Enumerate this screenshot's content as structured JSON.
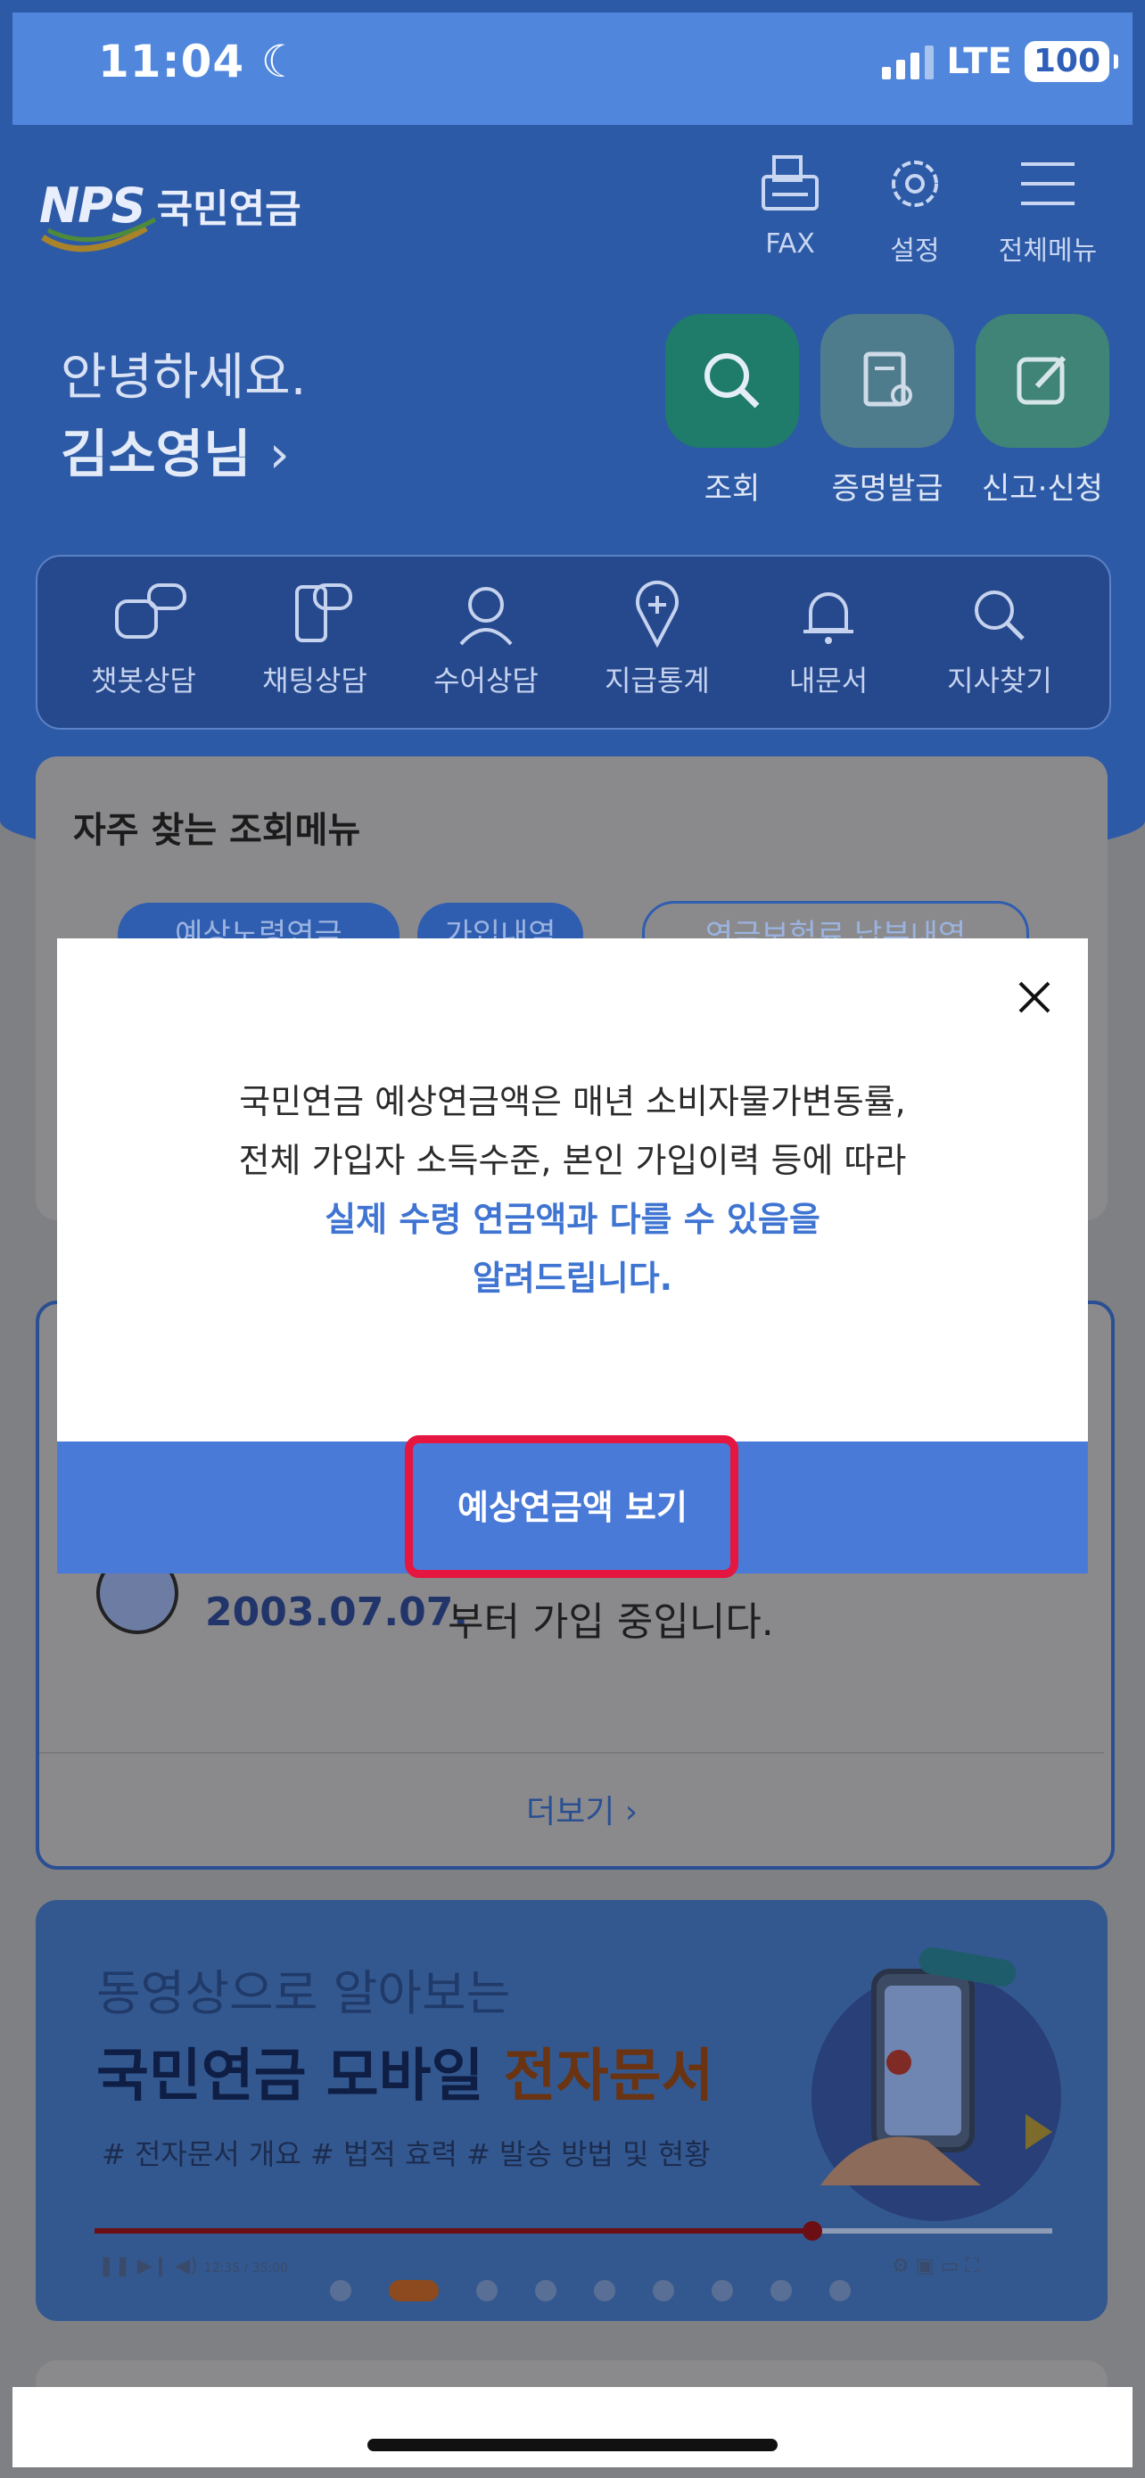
{
  "status_bar": {
    "time": "11:04",
    "network": "LTE",
    "battery": "100"
  },
  "header": {
    "logo_mark": "NPS",
    "logo_name": "국민연금",
    "icons": [
      {
        "label": "FAX",
        "icon": "fax-icon"
      },
      {
        "label": "설정",
        "icon": "gear-icon"
      },
      {
        "label": "전체메뉴",
        "icon": "hamburger-menu-icon"
      }
    ]
  },
  "greeting": {
    "line1": "안녕하세요.",
    "name": "김소영님",
    "chevron": "›"
  },
  "quick_actions": [
    {
      "label": "조회",
      "icon": "search-icon"
    },
    {
      "label": "증명발급",
      "icon": "certificate-icon"
    },
    {
      "label": "신고·신청",
      "icon": "edit-icon"
    }
  ],
  "service_menu": [
    {
      "label": "챗봇상담",
      "icon": "chatbot-icon"
    },
    {
      "label": "채팅상담",
      "icon": "chat-phone-icon"
    },
    {
      "label": "수어상담",
      "icon": "sign-language-icon"
    },
    {
      "label": "지급통계",
      "icon": "map-pin-icon"
    },
    {
      "label": "내문서",
      "icon": "bell-icon"
    },
    {
      "label": "지사찾기",
      "icon": "magnifier-icon"
    }
  ],
  "frequent": {
    "title": "자주 찾는 조회메뉴",
    "pills": [
      "예상노령연금",
      "가입내역",
      "연금보험료 납부내역"
    ]
  },
  "membership": {
    "date": "2003.07.07.",
    "suffix": "부터 가입 중입니다.",
    "more": "더보기 ›"
  },
  "banner": {
    "line1": "동영상으로 알아보는",
    "line2_main": "국민연금 모바일 ",
    "line2_accent": "전자문서",
    "tags": "# 전자문서 개요   # 법적 효력   # 발송 방법 및 현황",
    "player_time": "12:35 / 35:00",
    "progress": 0.75
  },
  "modal": {
    "line1": "국민연금 예상연금액은 매년 소비자물가변동률,",
    "line2": "전체 가입자 소득수준, 본인 가입이력 등에 따라",
    "line3": "실제 수령 연금액과 다를 수 있음을",
    "line4": "알려드립니다.",
    "button": "예상연금액 보기"
  },
  "colors": {
    "primary": "#4a7ad8",
    "accent_text": "#3f74d2",
    "highlight": "#e5163f"
  }
}
